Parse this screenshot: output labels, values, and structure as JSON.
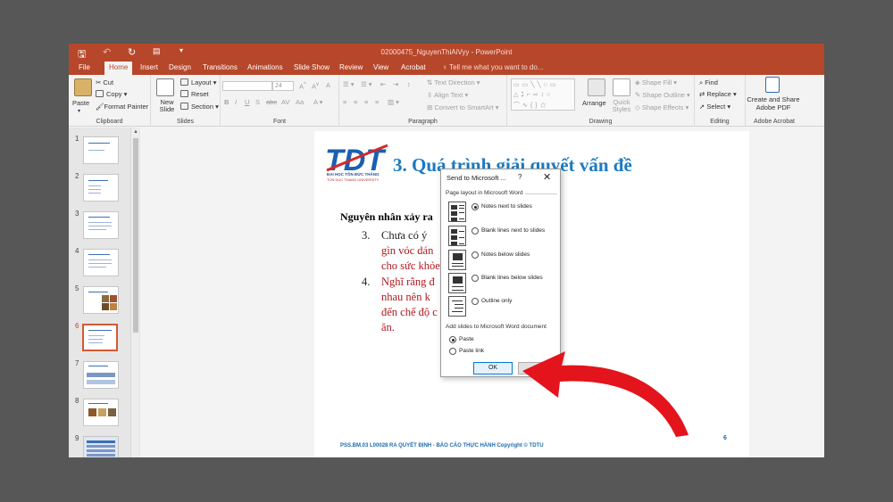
{
  "window": {
    "doc_title": "02000475_NguyenThiAiVyy - PowerPoint"
  },
  "tabs": [
    {
      "label": "File"
    },
    {
      "label": "Home"
    },
    {
      "label": "Insert"
    },
    {
      "label": "Design"
    },
    {
      "label": "Transitions"
    },
    {
      "label": "Animations"
    },
    {
      "label": "Slide Show"
    },
    {
      "label": "Review"
    },
    {
      "label": "View"
    },
    {
      "label": "Acrobat"
    }
  ],
  "tell_me": "Tell me what you want to do...",
  "ribbon": {
    "clipboard": {
      "paste": "Paste",
      "cut": "Cut",
      "copy": "Copy",
      "format_painter": "Format Painter",
      "group": "Clipboard"
    },
    "slides": {
      "new_slide": "New Slide",
      "layout": "Layout",
      "reset": "Reset",
      "section": "Section",
      "group": "Slides"
    },
    "font": {
      "size": "24",
      "group": "Font"
    },
    "paragraph": {
      "text_direction": "Text Direction",
      "align_text": "Align Text",
      "convert_smartart": "Convert to SmartArt",
      "group": "Paragraph"
    },
    "drawing": {
      "arrange": "Arrange",
      "quick_styles": "Quick Styles",
      "shape_fill": "Shape Fill",
      "shape_outline": "Shape Outline",
      "shape_effects": "Shape Effects",
      "group": "Drawing"
    },
    "editing": {
      "find": "Find",
      "replace": "Replace",
      "select": "Select",
      "group": "Editing"
    },
    "acrobat": {
      "create_share": "Create and Share Adobe PDF",
      "group": "Adobe Acrobat"
    }
  },
  "thumbnails": [
    {
      "num": "1"
    },
    {
      "num": "2"
    },
    {
      "num": "3"
    },
    {
      "num": "4"
    },
    {
      "num": "5"
    },
    {
      "num": "6",
      "selected": true
    },
    {
      "num": "7"
    },
    {
      "num": "8"
    },
    {
      "num": "9"
    }
  ],
  "slide": {
    "logo": "TDT",
    "logo_sub1": "ĐẠI HỌC TÔN ĐỨC THẮNG",
    "logo_sub2": "TON DUC THANG UNIVERSITY",
    "title": "3. Quá trình giải quyết vấn đề",
    "heading": "Nguyên nhân xảy ra",
    "items": [
      {
        "num": "3.",
        "lines": [
          "Chưa có ý",
          "gìn vóc dán",
          "cho sức khỏe"
        ]
      },
      {
        "num": "4.",
        "lines": [
          "Nghĩ rằng đ",
          "nhau nên k",
          "đến chế độ c",
          "ăn."
        ]
      }
    ],
    "footer": "PSS.BM.03 L00028 RA QUYẾT ĐỊNH - BÁO CÁO THỰC HÀNH Copyright © TDTU",
    "page_number": "6"
  },
  "dialog": {
    "title": "Send to Microsoft ...",
    "help": "?",
    "close": "✕",
    "layout_section": "Page layout in Microsoft Word",
    "layout_options": [
      {
        "label": "Notes next to slides",
        "checked": true
      },
      {
        "label": "Blank lines next to slides",
        "checked": false
      },
      {
        "label": "Notes below slides",
        "checked": false
      },
      {
        "label": "Blank lines below slides",
        "checked": false
      },
      {
        "label": "Outline only",
        "checked": false
      }
    ],
    "add_section": "Add slides to Microsoft Word document",
    "add_options": [
      {
        "label": "Paste",
        "checked": true
      },
      {
        "label": "Paste link",
        "checked": false
      }
    ],
    "ok": "OK"
  },
  "colors": {
    "accent": "#b7472a",
    "slide_title": "#1c7ac1",
    "annotation_arrow": "#e3141c"
  }
}
